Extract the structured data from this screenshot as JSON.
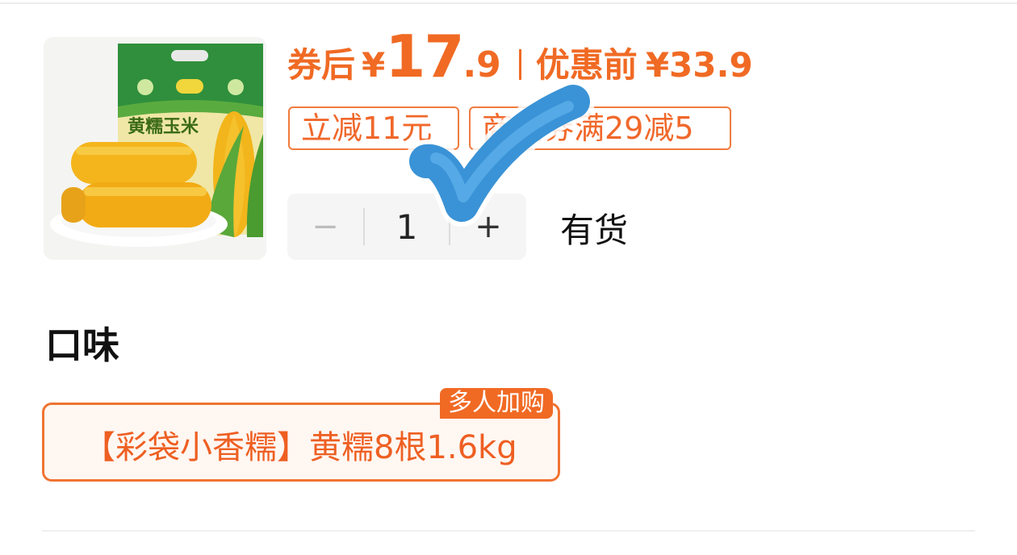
{
  "product": {
    "image_alt": "黄糯玉米",
    "package_text": "黄糯玉米"
  },
  "price": {
    "coupon_label": "券后",
    "currency": "¥",
    "coupon_price_int": "17",
    "coupon_price_dec": ".9",
    "original_label": "优惠前",
    "original_price": "¥33.9"
  },
  "tags": [
    {
      "text": "立减11元"
    },
    {
      "text": "商品券满29减5"
    }
  ],
  "quantity": {
    "minus": "−",
    "value": "1",
    "plus": "+"
  },
  "stock_status": "有货",
  "flavor": {
    "title": "口味",
    "options": [
      {
        "label": "【彩袋小香糯】黄糯8根1.6kg",
        "badge": "多人加购",
        "selected": true
      }
    ]
  },
  "colors": {
    "accent": "#f06a24",
    "check": "#3a93d6"
  },
  "icons": {
    "overlay": "checkmark-icon"
  }
}
